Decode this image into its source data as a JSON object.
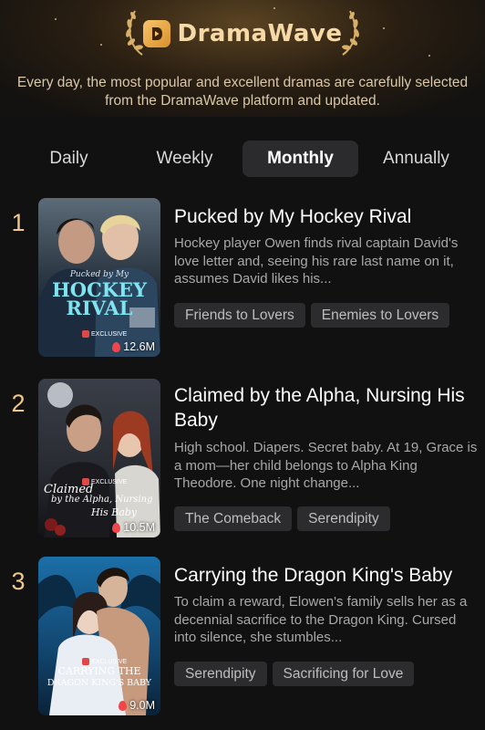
{
  "header": {
    "brand": "DramaWave",
    "tagline": "Every day, the most popular and excellent dramas are carefully selected from the DramaWave platform and updated."
  },
  "tabs": [
    {
      "label": "Daily",
      "active": false
    },
    {
      "label": "Weekly",
      "active": false
    },
    {
      "label": "Monthly",
      "active": true
    },
    {
      "label": "Annually",
      "active": false
    }
  ],
  "dramas": [
    {
      "rank": "1",
      "title": "Pucked by My Hockey Rival",
      "description": "Hockey player Owen finds rival captain David's love letter and, seeing his rare last name on it, assumes David likes his...",
      "tags": [
        "Friends to Lovers",
        "Enemies to Lovers"
      ],
      "views": "12.6M",
      "badge": "EXCLUSIVE",
      "cover_text": [
        "Pucked by My",
        "HOCKEY",
        "RIVAL"
      ]
    },
    {
      "rank": "2",
      "title": "Claimed by the Alpha, Nursing His Baby",
      "description": "High school. Diapers. Secret baby. At 19, Grace is a mom—her child belongs to Alpha King Theodore. One night change...",
      "tags": [
        "The Comeback",
        "Serendipity"
      ],
      "views": "10.5M",
      "badge": "EXCLUSIVE",
      "cover_text": [
        "Claimed",
        "by the Alpha, Nursing",
        "His Baby"
      ]
    },
    {
      "rank": "3",
      "title": "Carrying the Dragon King's Baby",
      "description": "To claim a reward, Elowen's family sells her as a decennial sacrifice to the Dragon King. Cursed into silence, she stumbles...",
      "tags": [
        "Serendipity",
        "Sacrificing for Love"
      ],
      "views": "9.0M",
      "badge": "EXCLUSIVE",
      "cover_text": [
        "CARRYING THE",
        "DRAGON KING'S BABY"
      ]
    }
  ]
}
